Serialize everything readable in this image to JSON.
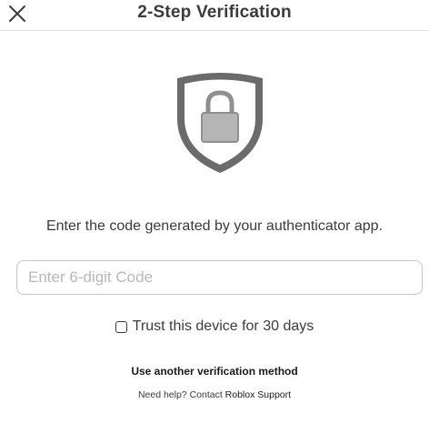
{
  "header": {
    "title": "2-Step Verification",
    "close_icon": "close-icon"
  },
  "shield": {
    "icon": "shield-lock-icon",
    "outer_color": "#6b6b6b",
    "inner_color": "#ffffff",
    "lock_color": "#b5b5b5"
  },
  "instruction": "Enter the code generated by your authenticator app.",
  "code_field": {
    "value": "",
    "placeholder": "Enter 6-digit Code"
  },
  "trust_device": {
    "label": "Trust this device for 30 days",
    "checked": false
  },
  "alt_method_label": "Use another verification method",
  "help": {
    "prefix": "Need help? Contact ",
    "link_label": "Roblox Support"
  }
}
